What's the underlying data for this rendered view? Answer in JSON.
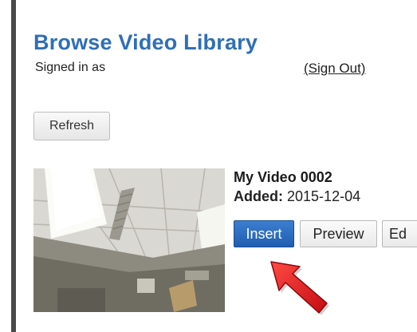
{
  "header": {
    "title": "Browse Video Library",
    "signed_in_label": "Signed in as",
    "sign_out_label": "(Sign Out)"
  },
  "toolbar": {
    "refresh_label": "Refresh"
  },
  "video": {
    "title": "My Video 0002",
    "added_label": "Added:",
    "added_date": "2015-12-04",
    "thumbnail_icon": "video-thumbnail-ceiling",
    "actions": {
      "insert_label": "Insert",
      "preview_label": "Preview",
      "edit_label": "Ed"
    }
  },
  "annotation": {
    "arrow_icon": "red-arrow-pointer",
    "arrow_color": "#e0141e"
  },
  "colors": {
    "title": "#2f6fb6",
    "insert_button": "#2a6cc2"
  }
}
